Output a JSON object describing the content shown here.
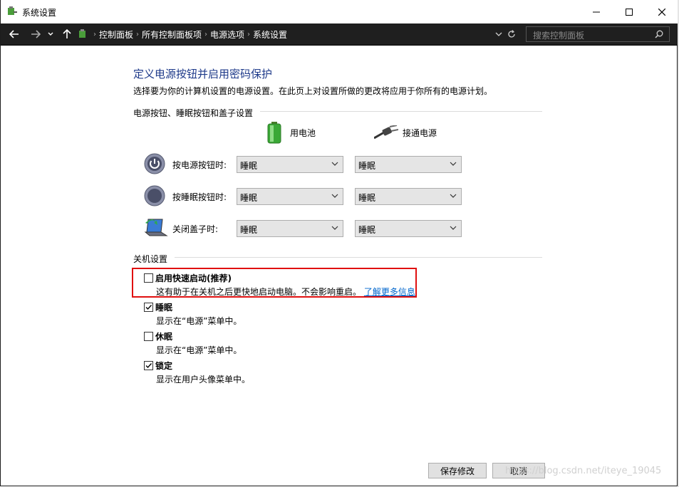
{
  "window": {
    "title": "系统设置"
  },
  "address": {
    "crumbs": [
      "控制面板",
      "所有控制面板项",
      "电源选项",
      "系统设置"
    ],
    "search_placeholder": "搜索控制面板"
  },
  "page": {
    "heading": "定义电源按钮并启用密码保护",
    "description": "选择要为你的计算机设置的电源设置。在此页上对设置所做的更改将应用于你所有的电源计划。"
  },
  "power_section": {
    "title": "电源按钮、睡眠按钮和盖子设置",
    "col_battery": "用电池",
    "col_plugged": "接通电源",
    "rows": [
      {
        "label": "按电源按钮时:",
        "battery": "睡眠",
        "plugged": "睡眠"
      },
      {
        "label": "按睡眠按钮时:",
        "battery": "睡眠",
        "plugged": "睡眠"
      },
      {
        "label": "关闭盖子时:",
        "battery": "睡眠",
        "plugged": "睡眠"
      }
    ]
  },
  "shutdown_section": {
    "title": "关机设置",
    "options": [
      {
        "label": "启用快速启动(推荐)",
        "checked": false,
        "desc": "这有助于在关机之后更快地启动电脑。不会影响重启。",
        "link": "了解更多信息"
      },
      {
        "label": "睡眠",
        "checked": true,
        "desc": "显示在“电源”菜单中。"
      },
      {
        "label": "休眠",
        "checked": false,
        "desc": "显示在“电源”菜单中。"
      },
      {
        "label": "锁定",
        "checked": true,
        "desc": "显示在用户头像菜单中。"
      }
    ]
  },
  "buttons": {
    "save": "保存修改",
    "cancel": "取消"
  },
  "watermark": "https://blog.csdn.net/iteye_19045",
  "colors": {
    "heading": "#1e3a8a",
    "link": "#0066cc",
    "highlight": "#e01010",
    "addressbar": "#1f1f1f"
  }
}
